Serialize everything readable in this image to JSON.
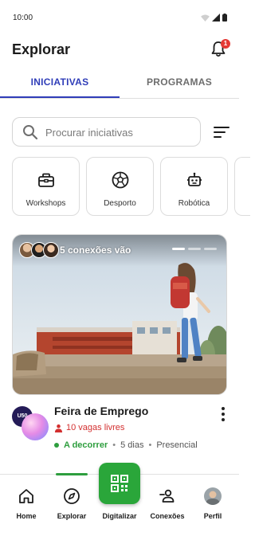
{
  "status_bar": {
    "time": "10:00"
  },
  "header": {
    "title": "Explorar",
    "notification_count": "1"
  },
  "tabs": [
    {
      "label": "INICIATIVAS",
      "active": true
    },
    {
      "label": "PROGRAMAS",
      "active": false
    }
  ],
  "search": {
    "placeholder": "Procurar iniciativas"
  },
  "categories": [
    {
      "label": "Workshops",
      "icon": "toolbox-icon"
    },
    {
      "label": "Desporto",
      "icon": "soccer-ball-icon"
    },
    {
      "label": "Robótica",
      "icon": "robot-icon"
    }
  ],
  "featured": {
    "connections_text": "5 conexões vão",
    "title": "Feira de Emprego",
    "org_logo_text": "U50",
    "vagas": "10 vagas livres",
    "status": "A decorrer",
    "duration": "5 dias",
    "mode": "Presencial",
    "pager_total": 3,
    "pager_active": 1
  },
  "bottom_nav": {
    "items": [
      {
        "label": "Home",
        "icon": "home-icon"
      },
      {
        "label": "Explorar",
        "icon": "compass-icon",
        "active": true
      },
      {
        "label": "Digitalizar",
        "icon": "qr-code-icon"
      },
      {
        "label": "Conexões",
        "icon": "connections-icon"
      },
      {
        "label": "Perfil",
        "icon": "avatar"
      }
    ]
  },
  "colors": {
    "accent": "#2f3db8",
    "green": "#2aa63a",
    "red": "#d32f2f"
  }
}
